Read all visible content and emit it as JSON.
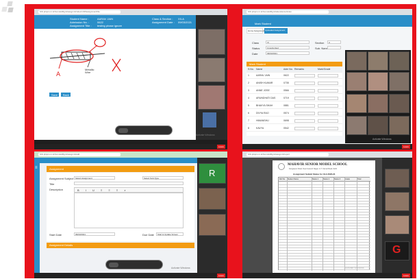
{
  "window_tl": {
    "urlbar": "hrbl.plinpro.in.kr/GurukulMgmt/assgmnt/index/x/18/assignmentFile",
    "fields": {
      "student_name_label": "Student Name :",
      "student_name": "AARAV JAIN",
      "admission_label": "Admission No. :",
      "admission": "0622",
      "title_label": "Assignment Title :",
      "title": "testing phase ignore",
      "class_label": "Class & Section :",
      "class": "XII-A",
      "date_label": "Assignment Date :",
      "date": "09/03/2021"
    },
    "diagram": {
      "label_a": "A",
      "label_b": "B",
      "note": "Metallic Wire",
      "cross": "X"
    },
    "buttons": {
      "save": "Save",
      "back": "Back"
    },
    "participants": [
      "",
      "",
      ""
    ],
    "activate_windows": "Activate Windows",
    "taskbar_end": "Leave"
  },
  "window_tr": {
    "urlbar": "hrbl.plinpro.in.kr/GurukulMgmt/attendance/index",
    "page_title": "Mark Student",
    "form_labels": [
      "Class",
      "Section",
      "Status",
      "Sub. Name",
      "Date"
    ],
    "form_values": [
      "XI",
      "A",
      "Unsubmitted",
      "",
      "09/03/2021"
    ],
    "tabs": [
      "Home Assignment",
      "Uploaded Assignment"
    ],
    "table_title": "Mark Student",
    "table_headers": [
      "S.No.",
      "Name",
      "Adm No.",
      "Remarks",
      "Mark/Grade"
    ],
    "table_rows": [
      [
        "1",
        "AARAV JAIN",
        "0622"
      ],
      [
        "2",
        "ANISH KUMAR",
        "0735"
      ],
      [
        "3",
        "ANNE JOSE",
        "0566"
      ],
      [
        "4",
        "ARUNDHATI DAS",
        "0719"
      ],
      [
        "5",
        "BHAVYA SHAH",
        "0881"
      ],
      [
        "6",
        "DIVYA RAO",
        "0574"
      ],
      [
        "7",
        "HIMANSHU",
        "0698"
      ],
      [
        "8",
        "KAVYA",
        "0542"
      ]
    ],
    "activate_windows": "Activate Windows",
    "taskbar_end": "Leave"
  },
  "window_bl": {
    "urlbar": "hrbl.plinpro.in.kr/GurukulMgmt/assgmnt/add",
    "page_title": "Assignment",
    "labels": [
      "Assignment Subject",
      "Title",
      "Description",
      "Start Date",
      "Due Date"
    ],
    "values": [
      "Select Assignment",
      "Select Sub-Type",
      "",
      "09/03/2021",
      "Start & Update Screen"
    ],
    "section_title": "Assignment Details",
    "participant_badge": "R",
    "activate_windows": "Activate Windows",
    "taskbar_end": "Leave"
  },
  "window_br": {
    "urlbar": "hrbl.plinpro.in.kr/GurukulMgmt/assgmnt/report",
    "school_name": "MAHAVIR SENIOR MODEL SCHOOL",
    "school_address": "Kanganpur Road, Near Ganesh Nagar, G.T. Karnal Road, Delhi",
    "report_title": "Assignment Submit Status for XI-A 2020-21",
    "table_headers": [
      "Roll No.",
      "Student Name",
      "Status 1",
      "Status 2",
      "Status 3",
      "Grade",
      "Total"
    ],
    "participant_badge": "G",
    "activate_windows": "Activate Windows",
    "taskbar_end": "Leave"
  },
  "colors": {
    "frame": "#e8121c",
    "header_blue": "#2a8ec8",
    "accent_orange": "#f39c12"
  }
}
